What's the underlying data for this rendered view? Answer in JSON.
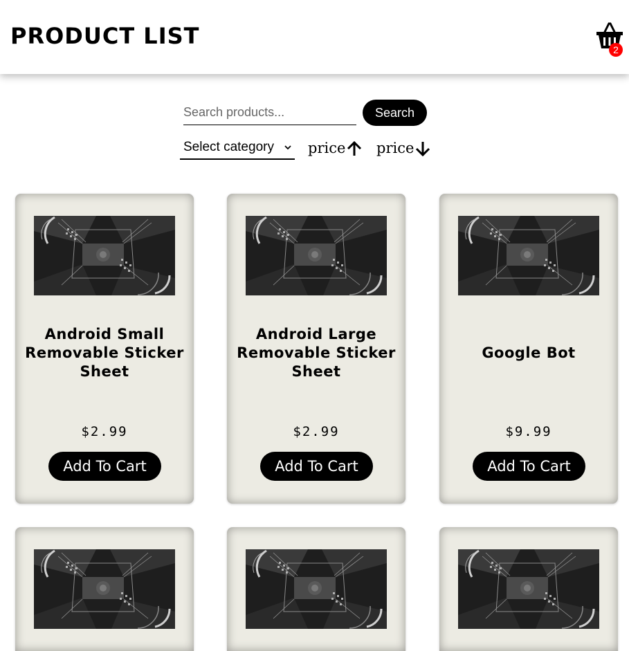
{
  "header": {
    "title": "PRODUCT LIST",
    "cart_count": "2",
    "cart_icon": "basket-icon",
    "badge_color": "#ff0000"
  },
  "search": {
    "placeholder": "Search products...",
    "value": "",
    "button_label": "Search",
    "icon": "none"
  },
  "filters": {
    "category_label": "Select category",
    "category_icon": "chevron-down-icon",
    "sort_asc_label": "price",
    "sort_asc_icon": "arrow-up-icon",
    "sort_desc_label": "price",
    "sort_desc_icon": "arrow-down-icon"
  },
  "products": [
    {
      "name": "Android Small Removable Sticker Sheet",
      "price": "$2.99",
      "button_label": "Add To Cart",
      "image_icon": "architecture-photo"
    },
    {
      "name": "Android Large Removable Sticker Sheet",
      "price": "$2.99",
      "button_label": "Add To Cart",
      "image_icon": "architecture-photo"
    },
    {
      "name": "Google Bot",
      "price": "$9.99",
      "button_label": "Add To Cart",
      "image_icon": "architecture-photo"
    },
    {
      "name": "",
      "price": "",
      "button_label": "",
      "image_icon": "architecture-photo"
    },
    {
      "name": "",
      "price": "",
      "button_label": "",
      "image_icon": "architecture-photo"
    },
    {
      "name": "",
      "price": "",
      "button_label": "",
      "image_icon": "architecture-photo"
    }
  ],
  "colors": {
    "card_background": "#ecebe3",
    "button_background": "#000000",
    "button_text": "#ffffff"
  }
}
